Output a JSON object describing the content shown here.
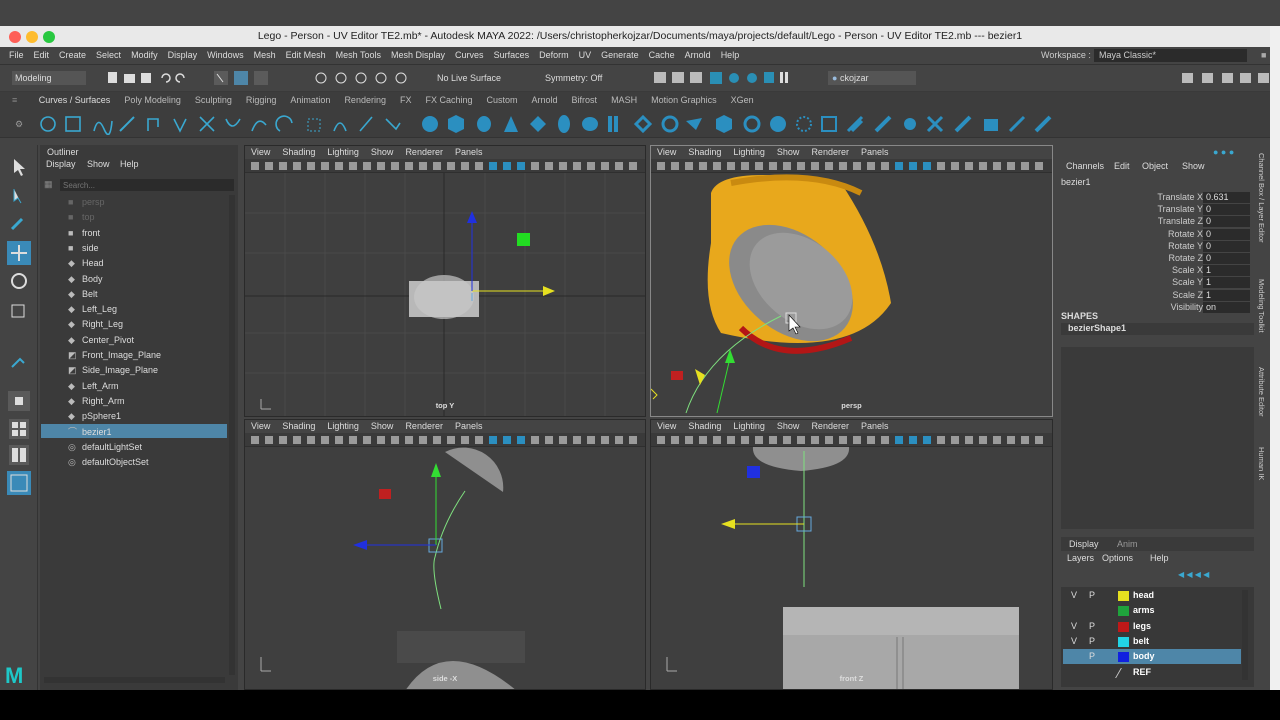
{
  "window": {
    "title": "Lego - Person - UV Editor TE2.mb* - Autodesk MAYA 2022: /Users/christopherkojzar/Documents/maya/projects/default/Lego - Person - UV Editor TE2.mb  ---  bezier1"
  },
  "menu": [
    "File",
    "Edit",
    "Create",
    "Select",
    "Modify",
    "Display",
    "Windows",
    "Mesh",
    "Edit Mesh",
    "Mesh Tools",
    "Mesh Display",
    "Curves",
    "Surfaces",
    "Deform",
    "UV",
    "Generate",
    "Cache",
    "Arnold",
    "Help"
  ],
  "workspace": {
    "label": "Workspace :",
    "value": "Maya Classic*"
  },
  "toolbar": {
    "mode": "Modeling",
    "live_surface": "No Live Surface",
    "symmetry": "Symmetry: Off",
    "user": "ckojzar"
  },
  "shelf_tabs": [
    "Curves / Surfaces",
    "Poly Modeling",
    "Sculpting",
    "Rigging",
    "Animation",
    "Rendering",
    "FX",
    "FX Caching",
    "Custom",
    "Arnold",
    "Bifrost",
    "MASH",
    "Motion Graphics",
    "XGen"
  ],
  "outliner": {
    "title": "Outliner",
    "menu": [
      "Display",
      "Show",
      "Help"
    ],
    "search_placeholder": "Search...",
    "items": [
      {
        "label": "persp",
        "icon": "camera-icon",
        "dim": true
      },
      {
        "label": "top",
        "icon": "camera-icon",
        "dim": true
      },
      {
        "label": "front",
        "icon": "camera-icon"
      },
      {
        "label": "side",
        "icon": "camera-icon"
      },
      {
        "label": "Head",
        "icon": "mesh-icon"
      },
      {
        "label": "Body",
        "icon": "mesh-icon"
      },
      {
        "label": "Belt",
        "icon": "mesh-icon"
      },
      {
        "label": "Left_Leg",
        "icon": "mesh-icon"
      },
      {
        "label": "Right_Leg",
        "icon": "mesh-icon"
      },
      {
        "label": "Center_Pivot",
        "icon": "mesh-icon"
      },
      {
        "label": "Front_Image_Plane",
        "icon": "image-plane-icon"
      },
      {
        "label": "Side_Image_Plane",
        "icon": "image-plane-icon"
      },
      {
        "label": "Left_Arm",
        "icon": "mesh-icon"
      },
      {
        "label": "Right_Arm",
        "icon": "mesh-icon"
      },
      {
        "label": "pSphere1",
        "icon": "mesh-icon"
      },
      {
        "label": "bezier1",
        "icon": "curve-icon",
        "selected": true
      },
      {
        "label": "defaultLightSet",
        "icon": "set-icon"
      },
      {
        "label": "defaultObjectSet",
        "icon": "set-icon"
      }
    ]
  },
  "viewport_menu": [
    "View",
    "Shading",
    "Lighting",
    "Show",
    "Renderer",
    "Panels"
  ],
  "viewports": {
    "top": "top Y",
    "persp": "persp",
    "side": "side -X",
    "front": "front Z"
  },
  "channel_box": {
    "menu": [
      "Channels",
      "Edit",
      "Object",
      "Show"
    ],
    "object": "bezier1",
    "channels": [
      {
        "name": "Translate X",
        "value": "0.631"
      },
      {
        "name": "Translate Y",
        "value": "0"
      },
      {
        "name": "Translate Z",
        "value": "0"
      },
      {
        "name": "Rotate X",
        "value": "0"
      },
      {
        "name": "Rotate Y",
        "value": "0"
      },
      {
        "name": "Rotate Z",
        "value": "0"
      },
      {
        "name": "Scale X",
        "value": "1"
      },
      {
        "name": "Scale Y",
        "value": "1"
      },
      {
        "name": "Scale Z",
        "value": "1"
      },
      {
        "name": "Visibility",
        "value": "on"
      }
    ],
    "shapes_header": "SHAPES",
    "shape": "bezierShape1"
  },
  "layer_editor": {
    "tabs": [
      "Display",
      "Anim"
    ],
    "menu": [
      "Layers",
      "Options",
      "Help"
    ],
    "layers": [
      {
        "v": "V",
        "p": "P",
        "name": "head",
        "color": "#e6e020"
      },
      {
        "v": "",
        "p": "",
        "name": "arms",
        "color": "#1fa33c"
      },
      {
        "v": "V",
        "p": "P",
        "name": "legs",
        "color": "#c01818"
      },
      {
        "v": "V",
        "p": "P",
        "name": "belt",
        "color": "#22d4e6"
      },
      {
        "v": "",
        "p": "P",
        "name": "body",
        "color": "#1020e0",
        "selected": true
      },
      {
        "v": "",
        "p": "",
        "name": "REF",
        "color": ""
      }
    ]
  },
  "side_tabs": [
    "Channel Box / Layer Editor",
    "Modeling Toolkit",
    "Attribute Editor",
    "Human IK"
  ],
  "colors": {
    "accent": "#4e9fc0",
    "selection": "#4e86a8",
    "maya_logo": "#1ec8c8"
  }
}
